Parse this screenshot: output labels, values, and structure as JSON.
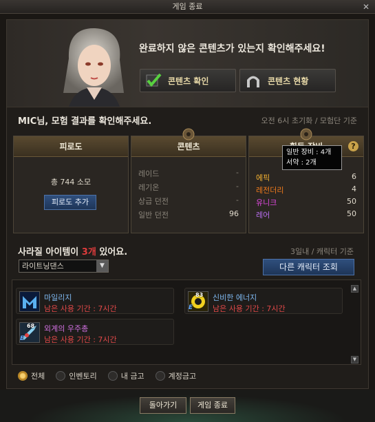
{
  "window": {
    "title": "게임 종료"
  },
  "banner": {
    "message": "완료하지 않은 콘텐츠가 있는지 확인해주세요!",
    "check_button": "콘텐츠 확인",
    "status_button": "콘텐츠 현황"
  },
  "result": {
    "title": "MIC님, 모험 결과를 확인해주세요.",
    "reset_info": "오전 6시 초기화 / 모험단 기준"
  },
  "fatigue": {
    "header": "피로도",
    "text": "총 744 소모",
    "add_button": "피로도 추가"
  },
  "contents": {
    "header": "콘텐츠",
    "rows": [
      {
        "label": "레이드",
        "value": "-"
      },
      {
        "label": "레기온",
        "value": "-"
      },
      {
        "label": "상급 던전",
        "value": "-"
      },
      {
        "label": "일반 던전",
        "value": "96"
      }
    ]
  },
  "gear": {
    "header": "획득 장비",
    "tooltip_line1": "일반 장비 : 4개",
    "tooltip_line2": "서약 : 2개",
    "help": "?",
    "rows": [
      {
        "label": "에픽",
        "value": "6",
        "color": "#f4b232"
      },
      {
        "label": "레전더리",
        "value": "4",
        "color": "#ee7a1c"
      },
      {
        "label": "유니크",
        "value": "50",
        "color": "#e24ae2"
      },
      {
        "label": "레어",
        "value": "50",
        "color": "#b86ef0"
      }
    ]
  },
  "vanish": {
    "title_prefix": "사라질 아이템이 ",
    "count": "3개",
    "title_suffix": " 있어요.",
    "info": "3일내 / 캐릭터 기준",
    "select_value": "라이트닝댄스",
    "other_char_button": "다른 캐릭터 조회",
    "items": [
      {
        "name": "마일리지",
        "remaining": "남은 사용 기간 : 7시간",
        "name_color": "#7fb8f0"
      },
      {
        "name": "신비한 에너지",
        "remaining": "남은 사용 기간 : 7시간",
        "name_color": "#7fb8f0",
        "level": "83"
      },
      {
        "name": "외계의 우주총",
        "remaining": "남은 사용 기간 : 7시간",
        "name_color": "#d070e0",
        "level": "68"
      }
    ]
  },
  "filters": [
    {
      "label": "전체",
      "selected": true
    },
    {
      "label": "인벤토리",
      "selected": false
    },
    {
      "label": "내 금고",
      "selected": false
    },
    {
      "label": "계정금고",
      "selected": false
    }
  ],
  "footer": {
    "back_button": "돌아가기",
    "exit_button": "게임 종료"
  }
}
